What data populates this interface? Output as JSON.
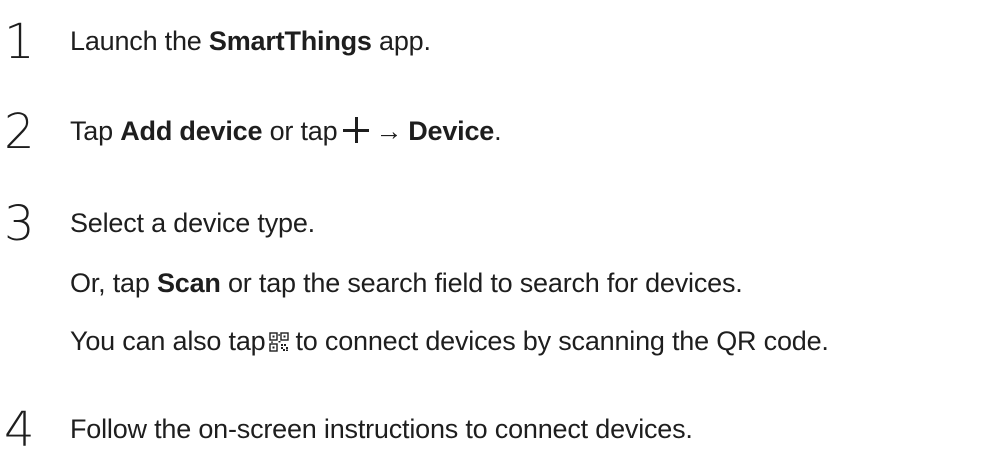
{
  "steps": [
    {
      "number": "1",
      "lines": [
        {
          "pre": "Launch the ",
          "bold": "SmartThings",
          "post": " app."
        }
      ]
    },
    {
      "number": "2",
      "line": {
        "pre": "Tap ",
        "bold1": "Add device",
        "mid": " or tap",
        "arrow": "→",
        "bold2": "Device",
        "post": "."
      }
    },
    {
      "number": "3",
      "line1": "Select a device type.",
      "line2": {
        "pre": "Or, tap ",
        "bold": "Scan",
        "post": " or tap the search field to search for devices."
      },
      "line3": {
        "pre": "You can also tap",
        "post": "to connect devices by scanning the QR code."
      }
    },
    {
      "number": "4",
      "line": "Follow the on-screen instructions to connect devices."
    }
  ],
  "icons": {
    "plus": "plus-icon",
    "qr": "qr-code-icon"
  }
}
